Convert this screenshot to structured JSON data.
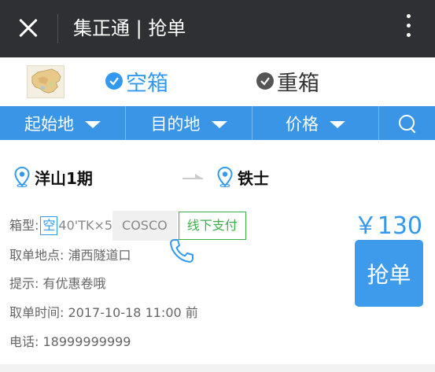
{
  "header": {
    "title": "集正通 | 抢单"
  },
  "type_selector": {
    "options": [
      {
        "label": "空箱",
        "selected": true
      },
      {
        "label": "重箱",
        "selected": false
      }
    ]
  },
  "filters": {
    "items": [
      {
        "label": "起始地"
      },
      {
        "label": "目的地"
      },
      {
        "label": "价格"
      }
    ],
    "search_icon": "search-icon"
  },
  "order": {
    "from": "洋山1期",
    "to": "铁士",
    "box_type_label": "箱型:",
    "box_kind": "空",
    "box_size": "40'TK×5",
    "carrier": "COSCO",
    "payment": "线下支付",
    "pickup_label": "取单地点:",
    "pickup_value": "浦西隧道口",
    "hint_label": "提示:",
    "hint_value": "有优惠卷哦",
    "time_label": "取单时间:",
    "time_value": "2017-10-18 11:00 前",
    "phone_label": "电话:",
    "phone_value": "18999999999",
    "price": "￥130",
    "grab_label": "抢单"
  },
  "colors": {
    "accent": "#3b95e6",
    "header_bg": "#2f3033",
    "pay_green": "#3bb04a"
  }
}
